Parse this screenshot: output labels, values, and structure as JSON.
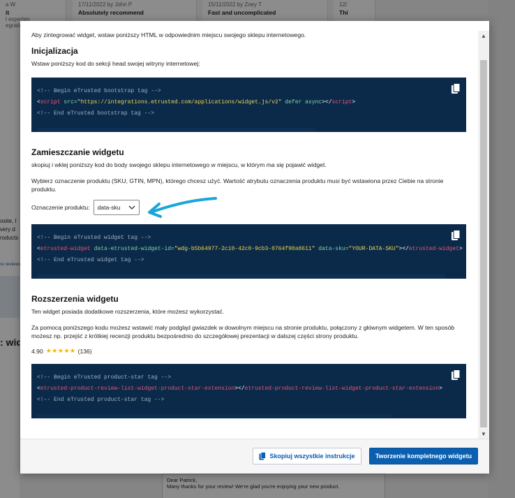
{
  "background": {
    "cards": [
      {
        "date": "a W",
        "title": "it",
        "line1": "l experien",
        "line2": "egrations."
      },
      {
        "date": "17/11/2022 by John P",
        "title": "Absolutely recommend"
      },
      {
        "date": "15/11/2022 by Zoey T",
        "title": "Fast and uncomplicated"
      },
      {
        "date": "12/",
        "title": "Thi"
      }
    ],
    "left_text": [
      "osite, I",
      "very d",
      "roducts"
    ],
    "left_link": "re reviews",
    "section_fragment": ": wid",
    "reply_name": "Dear Patrick,",
    "reply_text": "Many thanks for your review! We're glad you're enjoying your new product."
  },
  "modal": {
    "intro": "Aby zintegrować widget, wstaw poniższy HTML w odpowiednim miejscu swojego sklepu internetowego.",
    "sections": {
      "init": {
        "title": "Inicjalizacja",
        "desc": "Wstaw poniższy kod do sekcji head swojej witryny internetowej:",
        "code": {
          "comment_start": "<!-- Begin eTrusted bootstrap tag -->",
          "open_lt": "<",
          "tag": "script",
          "attr1": " src=",
          "val1": "\"https://integrations.etrusted.com/applications/widget.js/v2\"",
          "attr2": " defer async",
          "close_mid": "></",
          "tag_close": "script",
          "gt": ">",
          "comment_end": "<!-- End eTrusted bootstrap tag -->"
        }
      },
      "placement": {
        "title": "Zamieszczanie widgetu",
        "desc": "skopiuj i wklej poniższy kod do body swojego sklepu internetowego w miejscu, w którym ma się pojawić widget.",
        "desc2": "Wybierz oznaczenie produktu (SKU, GTIN, MPN), którego chcesz użyć. Wartość atrybutu oznaczenia produktu musi być wstawiona przez Ciebie na stronie produktu.",
        "select_label": "Oznaczenie produktu:",
        "select_value": "data-sku",
        "code": {
          "comment_start": "<!-- Begin eTrusted widget tag -->",
          "open_lt": "<",
          "tag": "etrusted-widget",
          "attr1": " data-etrusted-widget-id=",
          "val1": "\"wdg-b5b64977-2c10-42c0-9cb3-0764f90a8611\"",
          "attr2": " data-sku=",
          "val2": "\"YOUR-DATA-SKU\"",
          "close_mid": "></",
          "tag_close": "etrusted-widget",
          "gt": ">",
          "comment_end": "<!-- End eTrusted widget tag -->"
        }
      },
      "extensions": {
        "title": "Rozszerzenia widgetu",
        "desc": "Ten widget posiada dodatkowe rozszerzenia, które możesz wykorzystać.",
        "desc2": "Za pomocą poniższego kodu możesz wstawić mały podgląd gwiazdek w dowolnym miejscu na stronie produktu, połączony z głównym widgetem. W ten sposób możesz np. przejść z krótkiej recenzji produktu bezpośrednio do szczegółowej prezentacji w dalszej części strony produktu.",
        "rating": "4.90",
        "stars": "★★★★★",
        "rating_count": "(136)",
        "code": {
          "comment_start": "<!-- Begin eTrusted product-star tag -->",
          "open_lt": "<",
          "tag": "etrusted-product-review-list-widget-product-star-extension",
          "close_mid": "></",
          "tag_close": "etrusted-product-review-list-widget-product-star-extension",
          "gt": ">",
          "comment_end": "<!-- End eTrusted product-star tag -->"
        }
      }
    },
    "footer": {
      "copy_all_label": "Skopiuj wszystkie instrukcje",
      "create_label": "Tworzenie kompletnego widgetu"
    }
  },
  "colors": {
    "code_bg": "#0b2a4a",
    "primary": "#0b5fb0",
    "arrow": "#1aa6d8"
  },
  "icons": {
    "copy": "copy-icon",
    "chevron": "chevron-down-icon",
    "arrow": "arrow-icon"
  }
}
